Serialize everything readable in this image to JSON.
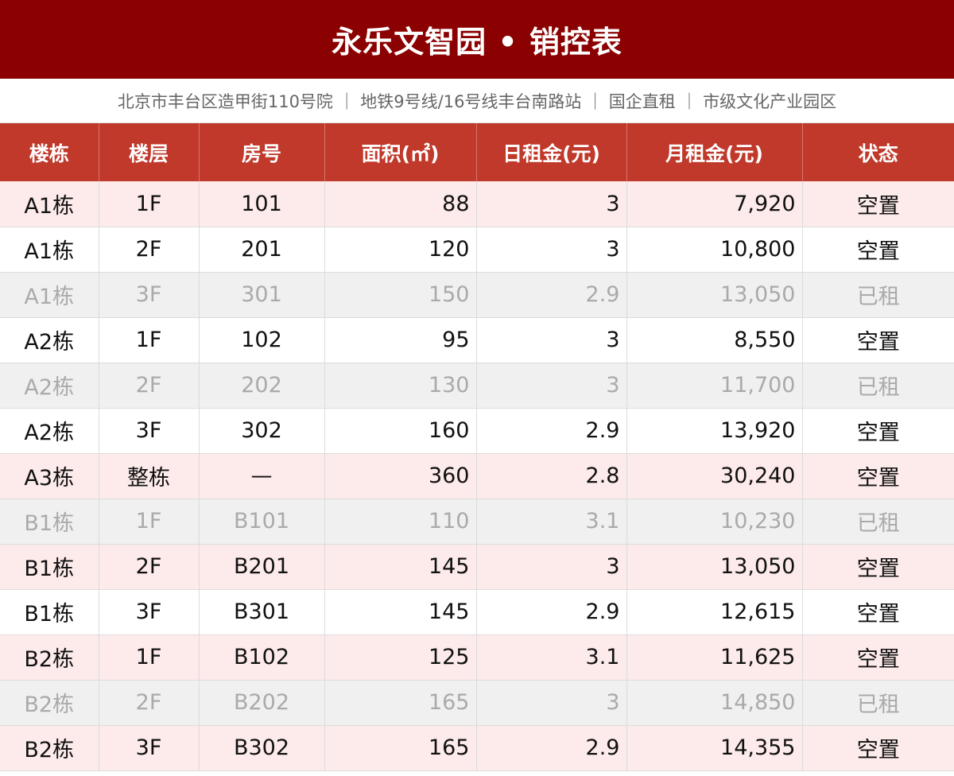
{
  "header": {
    "title": "永乐文智园 • 销控表",
    "subtitle": "北京市丰台区造甲街110号院 ｜ 地铁9号线/16号线丰台南路站 ｜ 国企直租 ｜ 市级文化产业园区"
  },
  "table": {
    "columns": [
      "楼栋",
      "楼层",
      "房号",
      "面积(㎡)",
      "日租金(元)",
      "月租金(元)",
      "状态"
    ],
    "rows": [
      {
        "building": "A1栋",
        "floor": "1F",
        "room": "101",
        "area": "88",
        "daily_rent": "3",
        "monthly_rent": "7,920",
        "status": "空置",
        "style": "pink"
      },
      {
        "building": "A1栋",
        "floor": "2F",
        "room": "201",
        "area": "120",
        "daily_rent": "3",
        "monthly_rent": "10,800",
        "status": "空置",
        "style": "white"
      },
      {
        "building": "A1栋",
        "floor": "3F",
        "room": "301",
        "area": "150",
        "daily_rent": "2.9",
        "monthly_rent": "13,050",
        "status": "已租",
        "style": "rented"
      },
      {
        "building": "A2栋",
        "floor": "1F",
        "room": "102",
        "area": "95",
        "daily_rent": "3",
        "monthly_rent": "8,550",
        "status": "空置",
        "style": "white"
      },
      {
        "building": "A2栋",
        "floor": "2F",
        "room": "202",
        "area": "130",
        "daily_rent": "3",
        "monthly_rent": "11,700",
        "status": "已租",
        "style": "rented"
      },
      {
        "building": "A2栋",
        "floor": "3F",
        "room": "302",
        "area": "160",
        "daily_rent": "2.9",
        "monthly_rent": "13,920",
        "status": "空置",
        "style": "white"
      },
      {
        "building": "A3栋",
        "floor": "整栋",
        "room": "—",
        "area": "360",
        "daily_rent": "2.8",
        "monthly_rent": "30,240",
        "status": "空置",
        "style": "pink"
      },
      {
        "building": "B1栋",
        "floor": "1F",
        "room": "B101",
        "area": "110",
        "daily_rent": "3.1",
        "monthly_rent": "10,230",
        "status": "已租",
        "style": "rented"
      },
      {
        "building": "B1栋",
        "floor": "2F",
        "room": "B201",
        "area": "145",
        "daily_rent": "3",
        "monthly_rent": "13,050",
        "status": "空置",
        "style": "pink"
      },
      {
        "building": "B1栋",
        "floor": "3F",
        "room": "B301",
        "area": "145",
        "daily_rent": "2.9",
        "monthly_rent": "12,615",
        "status": "空置",
        "style": "white"
      },
      {
        "building": "B2栋",
        "floor": "1F",
        "room": "B102",
        "area": "125",
        "daily_rent": "3.1",
        "monthly_rent": "11,625",
        "status": "空置",
        "style": "pink"
      },
      {
        "building": "B2栋",
        "floor": "2F",
        "room": "B202",
        "area": "165",
        "daily_rent": "3",
        "monthly_rent": "14,850",
        "status": "已租",
        "style": "rented"
      },
      {
        "building": "B2栋",
        "floor": "3F",
        "room": "B302",
        "area": "165",
        "daily_rent": "2.9",
        "monthly_rent": "14,355",
        "status": "空置",
        "style": "pink"
      }
    ]
  },
  "colors": {
    "title_bg": "#8b0000",
    "header_bg": "#c0392b",
    "row_pink": "#fdeaea",
    "row_rented": "#f0f0f0",
    "rented_text": "#aaaaaa"
  }
}
